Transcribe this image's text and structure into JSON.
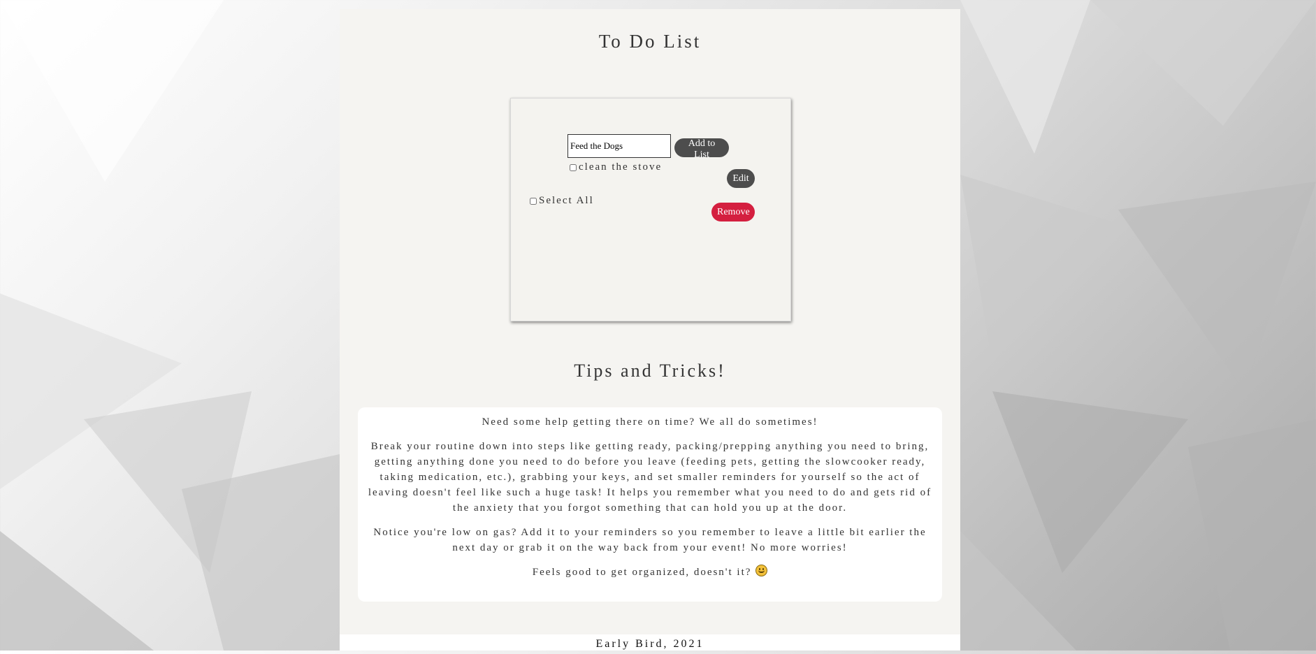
{
  "page": {
    "title": "To Do List"
  },
  "todo": {
    "input_value": "Feed the Dogs",
    "add_label": "Add to List",
    "items": [
      {
        "label": "clean the stove",
        "checked": false
      }
    ],
    "edit_label": "Edit",
    "select_all_label": "Select All",
    "remove_label": "Remove"
  },
  "tips": {
    "title": "Tips and Tricks!",
    "paragraphs": [
      "Need some help getting there on time? We all do sometimes!",
      "Break your routine down into steps like getting ready, packing/prepping anything you need to bring, getting anything done you need to do before you leave (feeding pets, getting the slowcooker ready, taking medication, etc.), grabbing your keys, and set smaller reminders for yourself so the act of leaving doesn't feel like such a huge task! It helps you remember what you need to do and gets rid of the anxiety that you forgot something that can hold you up at the door.",
      "Notice you're low on gas? Add it to your reminders so you remember to leave a little bit earlier the next day or grab it on the way back from your event! No more worries!",
      "Feels good to get organized, doesn't it?"
    ],
    "emoji_icon": "smile-emoji-icon"
  },
  "footer": {
    "text": "Early Bird, 2021"
  },
  "colors": {
    "dark_button": "#4d4d4d",
    "remove_button": "#d41f3f",
    "panel": "#f5f4f1"
  }
}
